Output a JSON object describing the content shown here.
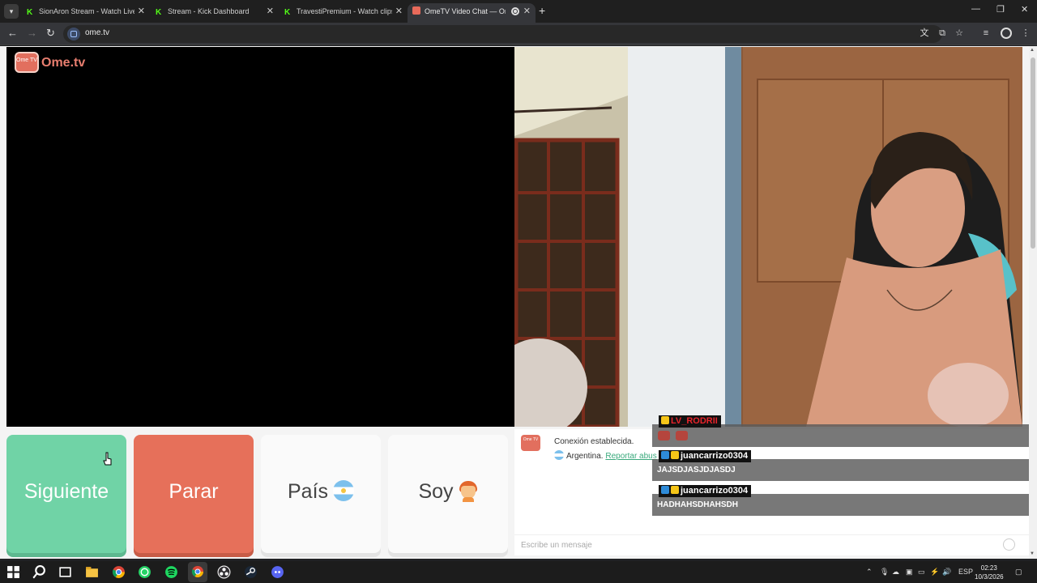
{
  "browser": {
    "tabs": [
      {
        "title": "SionAron Stream - Watch Live c",
        "favicon": "kick-icon"
      },
      {
        "title": "Stream - Kick Dashboard",
        "favicon": "kick-icon"
      },
      {
        "title": "TravestiPremium - Watch clips c",
        "favicon": "kick-icon"
      },
      {
        "title": "OmeTV Video Chat — Ome",
        "favicon": "ometv-icon",
        "active": true
      }
    ],
    "url": "ome.tv"
  },
  "page": {
    "logo_text": "Ome.tv",
    "logo_icon_text": "Ome TV",
    "buttons": {
      "next": "Siguiente",
      "stop": "Parar",
      "country": "País",
      "soy": "Soy"
    },
    "chat": {
      "system_message": "Conexión establecida.",
      "country": "Argentina.",
      "report_link": "Reportar abus",
      "input_placeholder": "Escribe un mensaje"
    },
    "overlay": [
      {
        "user": "LV_RODRII",
        "message": "",
        "color": "#e8242b",
        "emotes": 2
      },
      {
        "user": "juancarrizo0304",
        "message": "JAJSDJASJDJASDJ",
        "color": "#ffffff"
      },
      {
        "user": "juancarrizo0304",
        "message": "HADHAHSDHAHSDH",
        "color": "#ffffff"
      }
    ]
  },
  "taskbar": {
    "language": "ESP",
    "time": "02:23",
    "date": "10/3/2026"
  },
  "colors": {
    "next_button": "#70d3a6",
    "stop_button": "#e6705a",
    "brand": "#e26f5e"
  }
}
